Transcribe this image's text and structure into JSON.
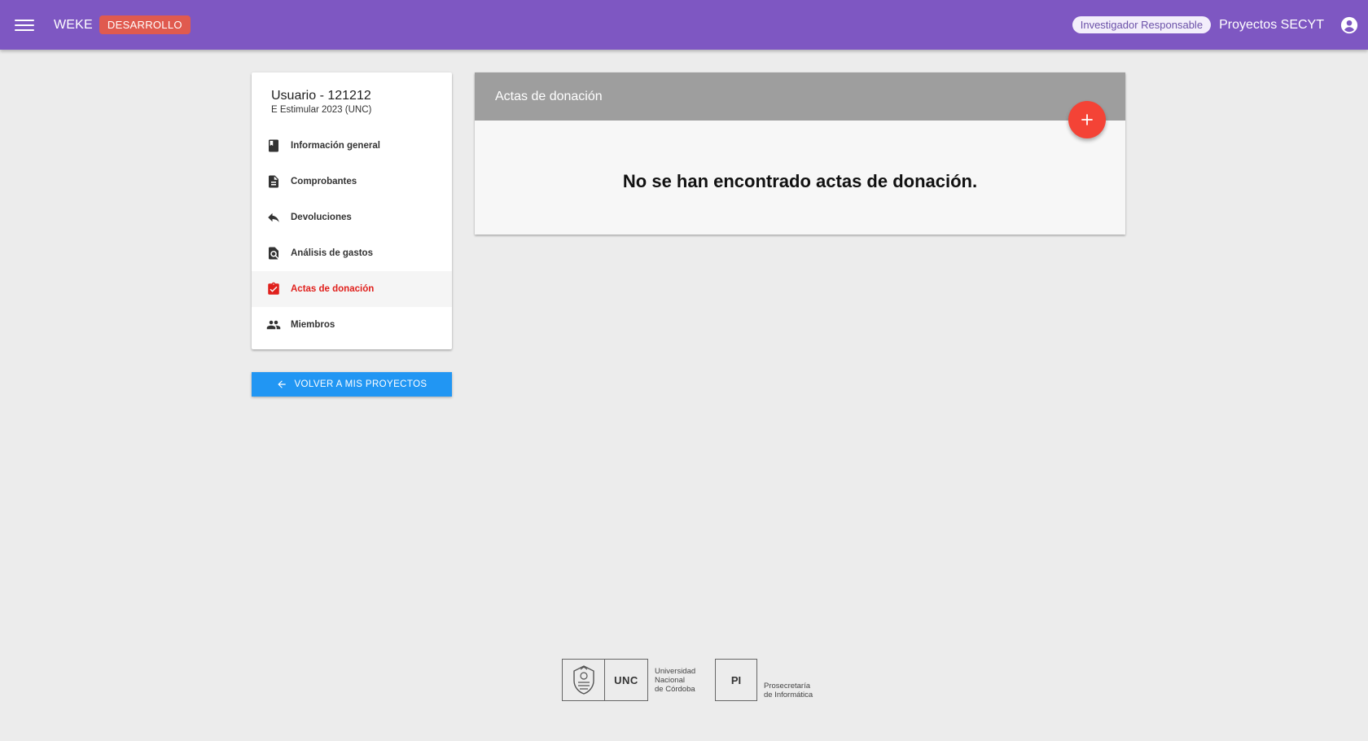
{
  "topbar": {
    "app_name": "WEKE",
    "env_badge": "DESARROLLO",
    "role_chip": "Investigador Responsable",
    "title": "Proyectos SECYT",
    "colors": {
      "bar": "#7e57c2",
      "badge": "#e05a4f"
    }
  },
  "sidebar": {
    "title": "Usuario - 121212",
    "subtitle": "E Estimular 2023 (UNC)",
    "items": [
      {
        "label": "Información general",
        "icon": "book-icon",
        "active": false
      },
      {
        "label": "Comprobantes",
        "icon": "document-icon",
        "active": false
      },
      {
        "label": "Devoluciones",
        "icon": "reply-icon",
        "active": false
      },
      {
        "label": "Análisis de gastos",
        "icon": "find-in-page-icon",
        "active": false
      },
      {
        "label": "Actas de donación",
        "icon": "assignment-check-icon",
        "active": true
      },
      {
        "label": "Miembros",
        "icon": "people-icon",
        "active": false
      }
    ],
    "back_button": "VOLVER A MIS PROYECTOS"
  },
  "main": {
    "header": "Actas de donación",
    "empty_message": "No se han encontrado actas de donación.",
    "fab_icon": "plus-icon"
  },
  "footer": {
    "unc_logo_text": "UNC",
    "unc_caption": [
      "Universidad",
      "Nacional",
      "de Córdoba"
    ],
    "pi_logo_text": "PI",
    "pi_caption": [
      "Prosecretaría",
      "de Informática"
    ]
  }
}
